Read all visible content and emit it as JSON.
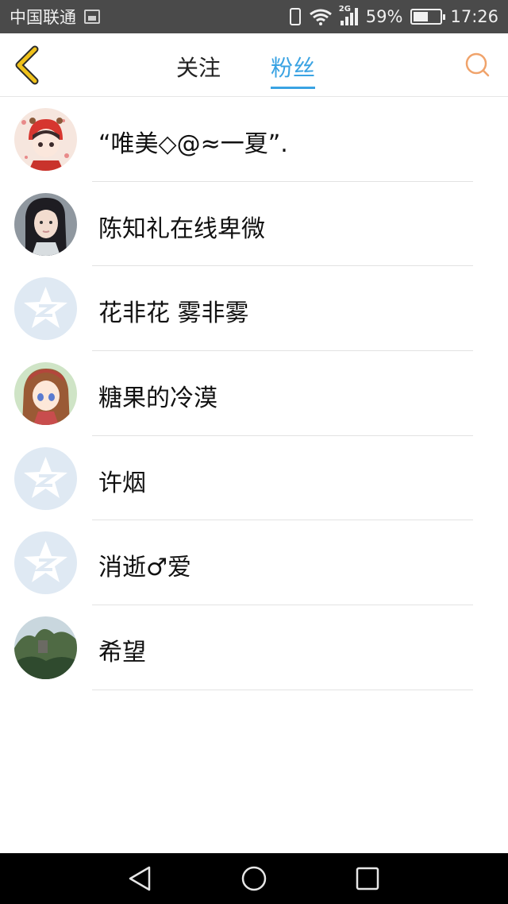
{
  "status_bar": {
    "carrier": "中国联通",
    "network": "2G",
    "battery_percent": "59%",
    "battery_level": 0.59,
    "time": "17:26",
    "colors": {
      "bar_bg": "#4a4a4a",
      "text": "#f0f0f0"
    }
  },
  "nav": {
    "back_icon": "chevron-left-icon",
    "tabs": [
      {
        "label": "关注",
        "active": false
      },
      {
        "label": "粉丝",
        "active": true
      }
    ],
    "search_icon": "search-icon",
    "colors": {
      "active_tab": "#3aa3e3",
      "back_icon": "#f0c21b",
      "search_icon": "#f0a36b"
    }
  },
  "fans": [
    {
      "name": "“唯美◇@≈一夏”.",
      "avatar": "girl-red-hood-avatar"
    },
    {
      "name": "陈知礼在线卑微",
      "avatar": "girl-photo-avatar"
    },
    {
      "name": "花非花 雾非雾",
      "avatar": "default-qzone-avatar"
    },
    {
      "name": "糖果的冷漠",
      "avatar": "anime-girl-avatar"
    },
    {
      "name": "许烟",
      "avatar": "default-qzone-avatar"
    },
    {
      "name": "消逝♂爱",
      "avatar": "default-qzone-avatar"
    },
    {
      "name": "希望",
      "avatar": "landscape-avatar"
    }
  ],
  "system_nav": {
    "keys": [
      "back-triangle-icon",
      "home-circle-icon",
      "recents-square-icon"
    ]
  }
}
